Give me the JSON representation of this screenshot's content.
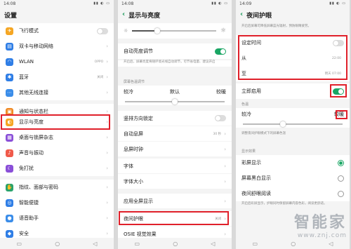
{
  "panel1": {
    "time": "14:08",
    "status_icons": "▮▮ ◐ ▭",
    "title": "设置",
    "items": [
      {
        "label": "飞行模式",
        "icon": "airplane-icon",
        "color": "#f5a623",
        "glyph": "✈"
      },
      {
        "label": "双卡与移动网络",
        "icon": "sim-card-icon",
        "color": "#2f7ee6",
        "glyph": "▤"
      },
      {
        "label": "WLAN",
        "icon": "wifi-icon",
        "color": "#2f7ee6",
        "glyph": "◠",
        "value": "OPPO"
      },
      {
        "label": "蓝牙",
        "icon": "bluetooth-icon",
        "color": "#2f7ee6",
        "glyph": "✱",
        "value": "关闭"
      },
      {
        "label": "其他无线连接",
        "icon": "link-icon",
        "color": "#3b8de9",
        "glyph": "⋯"
      },
      {
        "label": "通知与状态栏",
        "icon": "notification-icon",
        "color": "#f08a24",
        "glyph": "▣"
      },
      {
        "label": "显示与亮度",
        "icon": "brightness-icon",
        "color": "#f5a623",
        "glyph": "◐"
      },
      {
        "label": "桌面与锁屏杂志",
        "icon": "wallpaper-icon",
        "color": "#8a4fd8",
        "glyph": "▦"
      },
      {
        "label": "声音与振动",
        "icon": "sound-icon",
        "color": "#f05a4a",
        "glyph": "♪"
      },
      {
        "label": "免打扰",
        "icon": "moon-icon",
        "color": "#8a4fd8",
        "glyph": "☾"
      },
      {
        "label": "指纹、面部与密码",
        "icon": "fingerprint-icon",
        "color": "#2aa36b",
        "glyph": "✋"
      },
      {
        "label": "智能便捷",
        "icon": "smart-icon",
        "color": "#2f7ee6",
        "glyph": "◎"
      },
      {
        "label": "语音助手",
        "icon": "microphone-icon",
        "color": "#3b8de9",
        "glyph": "●"
      },
      {
        "label": "安全",
        "icon": "shield-icon",
        "color": "#2f7ee6",
        "glyph": "◆"
      }
    ]
  },
  "panel2": {
    "time": "14:08",
    "status_icons": "▮▮ ◐ ▭",
    "title": "显示与亮度",
    "brightness_level": 0.3,
    "auto_brightness": "自动亮度调节",
    "auto_note": "开启后，屏幕亮度将随环境光线自动调节，可节省电量、建议开启",
    "color_temp_section": "屏幕色温调节",
    "temp_cold": "较冷",
    "temp_default": "默认",
    "temp_warm": "较暖",
    "temp_level": 0.5,
    "items": [
      {
        "label": "竖排方向锁定"
      },
      {
        "label": "自动息屏",
        "value": "30 秒"
      },
      {
        "label": "息屏时钟"
      },
      {
        "label": "字体"
      },
      {
        "label": "字体大小"
      },
      {
        "label": "应用全屏显示"
      },
      {
        "label": "夜间护眼",
        "value": "关闭"
      },
      {
        "label": "OSIE 视觉效果"
      }
    ]
  },
  "panel3": {
    "time": "14:09",
    "status_icons": "▮▮ ◐ ▭",
    "title": "夜间护眼",
    "intro": "开启后屏幕可降低屏幕蓝光辐射，预防眼睛疲劳。",
    "schedule": "设定时间",
    "from_label": "从",
    "from_value": "22:00",
    "to_label": "至",
    "to_value": "明天 07:00",
    "enable_now": "立即启用",
    "temp_section": "色温",
    "temp_cold": "较冷",
    "temp_warm": "较暖",
    "temp_level": 0.4,
    "temp_note": "调整夜间护眼模式下的屏幕色温",
    "effect_section": "显示效果",
    "effects": [
      {
        "label": "彩屏显示",
        "selected": true
      },
      {
        "label": "屏幕黑白显示",
        "selected": false
      },
      {
        "label": "夜间舒眼阅读",
        "selected": false
      }
    ],
    "bottom_note": "开启后彩屏显示，护眼同时保留屏幕内容色彩，阅读更舒适。"
  },
  "watermark": {
    "line1": "智能家",
    "line2": "www.znj.com"
  }
}
